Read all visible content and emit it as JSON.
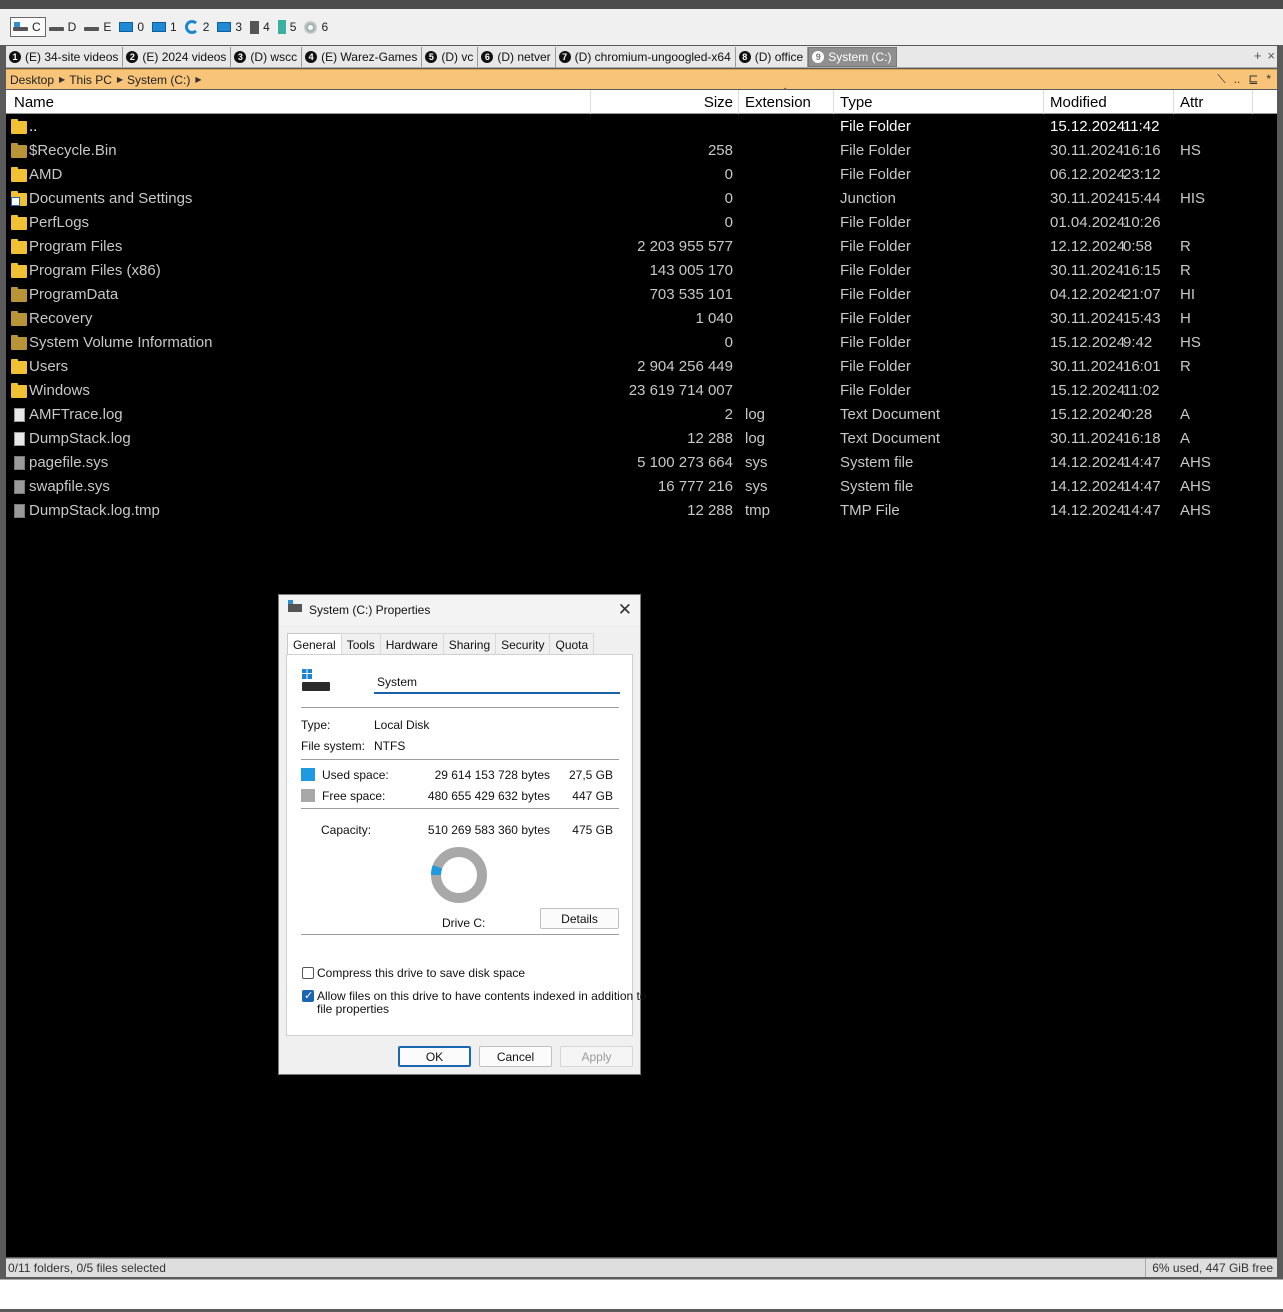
{
  "drives": [
    {
      "label": "C",
      "icon": "hdd-windows-icon",
      "active": true
    },
    {
      "label": "D",
      "icon": "hdd-icon"
    },
    {
      "label": "E",
      "icon": "hdd-icon"
    },
    {
      "label": "0",
      "icon": "monitor-icon"
    },
    {
      "label": "1",
      "icon": "network-icon"
    },
    {
      "label": "2",
      "icon": "internet-explorer-icon"
    },
    {
      "label": "3",
      "icon": "monitor-icon"
    },
    {
      "label": "4",
      "icon": "memory-card-icon"
    },
    {
      "label": "5",
      "icon": "book-icon"
    },
    {
      "label": "6",
      "icon": "disc-icon"
    }
  ],
  "tabs": [
    {
      "num": "1",
      "label": "(E) 34-site videos"
    },
    {
      "num": "2",
      "label": "(E) 2024 videos"
    },
    {
      "num": "3",
      "label": "(D) wscc"
    },
    {
      "num": "4",
      "label": "(E) Warez-Games"
    },
    {
      "num": "5",
      "label": "(D) vc"
    },
    {
      "num": "6",
      "label": "(D) netver"
    },
    {
      "num": "7",
      "label": "(D) chromium-ungoogled-x64"
    },
    {
      "num": "8",
      "label": "(D) office"
    },
    {
      "num": "9",
      "label": "System (C:)",
      "active": true
    }
  ],
  "tab_controls": {
    "add": "+",
    "close": "×"
  },
  "breadcrumb": [
    "Desktop",
    "This PC",
    "System (C:)"
  ],
  "address_right": {
    "tool1": "⟍",
    "tool2": "..",
    "tool3": "⊑",
    "tool4": "*"
  },
  "columns": {
    "name": "Name",
    "size": "Size",
    "extension": "Extension",
    "type": "Type",
    "modified": "Modified",
    "attr": "Attr"
  },
  "rows": [
    {
      "icon": "folder",
      "name": "..",
      "size": "",
      "ext": "",
      "type": "File Folder",
      "date": "15.12.2024",
      "time": "11:42",
      "attr": "",
      "parent": true
    },
    {
      "icon": "folder-hidden",
      "name": "$Recycle.Bin",
      "size": "258",
      "ext": "",
      "type": "File Folder",
      "date": "30.11.2024",
      "time": "16:16",
      "attr": "HS"
    },
    {
      "icon": "folder",
      "name": "AMD",
      "size": "0",
      "ext": "",
      "type": "File Folder",
      "date": "06.12.2024",
      "time": "23:12",
      "attr": ""
    },
    {
      "icon": "folder-junction",
      "name": "Documents and Settings",
      "size": "0",
      "ext": "",
      "type": "Junction",
      "date": "30.11.2024",
      "time": "15:44",
      "attr": "HIS"
    },
    {
      "icon": "folder",
      "name": "PerfLogs",
      "size": "0",
      "ext": "",
      "type": "File Folder",
      "date": "01.04.2024",
      "time": "10:26",
      "attr": ""
    },
    {
      "icon": "folder",
      "name": "Program Files",
      "size": "2 203 955 577",
      "ext": "",
      "type": "File Folder",
      "date": "12.12.2024",
      "time": "0:58",
      "attr": "R"
    },
    {
      "icon": "folder",
      "name": "Program Files (x86)",
      "size": "143 005 170",
      "ext": "",
      "type": "File Folder",
      "date": "30.11.2024",
      "time": "16:15",
      "attr": "R"
    },
    {
      "icon": "folder-hidden",
      "name": "ProgramData",
      "size": "703 535 101",
      "ext": "",
      "type": "File Folder",
      "date": "04.12.2024",
      "time": "21:07",
      "attr": "HI"
    },
    {
      "icon": "folder-hidden",
      "name": "Recovery",
      "size": "1 040",
      "ext": "",
      "type": "File Folder",
      "date": "30.11.2024",
      "time": "15:43",
      "attr": "H"
    },
    {
      "icon": "folder-hidden",
      "name": "System Volume Information",
      "size": "0",
      "ext": "",
      "type": "File Folder",
      "date": "15.12.2024",
      "time": "9:42",
      "attr": "HS"
    },
    {
      "icon": "folder",
      "name": "Users",
      "size": "2 904 256 449",
      "ext": "",
      "type": "File Folder",
      "date": "30.11.2024",
      "time": "16:01",
      "attr": "R"
    },
    {
      "icon": "folder",
      "name": "Windows",
      "size": "23 619 714 007",
      "ext": "",
      "type": "File Folder",
      "date": "15.12.2024",
      "time": "11:02",
      "attr": ""
    },
    {
      "icon": "file",
      "name": "AMFTrace.log",
      "size": "2",
      "ext": "log",
      "type": "Text Document",
      "date": "15.12.2024",
      "time": "0:28",
      "attr": "A"
    },
    {
      "icon": "file",
      "name": "DumpStack.log",
      "size": "12 288",
      "ext": "log",
      "type": "Text Document",
      "date": "30.11.2024",
      "time": "16:18",
      "attr": "A"
    },
    {
      "icon": "file-hidden",
      "name": "pagefile.sys",
      "size": "5 100 273 664",
      "ext": "sys",
      "type": "System file",
      "date": "14.12.2024",
      "time": "14:47",
      "attr": "AHS"
    },
    {
      "icon": "file-hidden",
      "name": "swapfile.sys",
      "size": "16 777 216",
      "ext": "sys",
      "type": "System file",
      "date": "14.12.2024",
      "time": "14:47",
      "attr": "AHS"
    },
    {
      "icon": "file-hidden",
      "name": "DumpStack.log.tmp",
      "size": "12 288",
      "ext": "tmp",
      "type": "TMP File",
      "date": "14.12.2024",
      "time": "14:47",
      "attr": "AHS"
    }
  ],
  "status": {
    "left": "0/11 folders, 0/5 files selected",
    "right": "6% used, 447 GiB free"
  },
  "dialog": {
    "title": "System (C:) Properties",
    "tabs": [
      "General",
      "Tools",
      "Hardware",
      "Sharing",
      "Security",
      "Quota"
    ],
    "volume_label": "System",
    "type_label": "Type:",
    "type_value": "Local Disk",
    "fs_label": "File system:",
    "fs_value": "NTFS",
    "used_label": "Used space:",
    "used_bytes": "29 614 153 728 bytes",
    "used_human": "27,5 GB",
    "free_label": "Free space:",
    "free_bytes": "480 655 429 632 bytes",
    "free_human": "447 GB",
    "capacity_label": "Capacity:",
    "capacity_bytes": "510 269 583 360 bytes",
    "capacity_human": "475 GB",
    "used_fraction": 0.058,
    "used_color": "#1f9ae0",
    "free_color": "#a8a8a8",
    "drive_label": "Drive C:",
    "details_button": "Details",
    "compress_label": "Compress this drive to save disk space",
    "compress_checked": false,
    "index_label_line1": "Allow files on this drive to have contents indexed in addition to",
    "index_label_line2": "file properties",
    "index_checked": true,
    "ok": "OK",
    "cancel": "Cancel",
    "apply": "Apply"
  }
}
